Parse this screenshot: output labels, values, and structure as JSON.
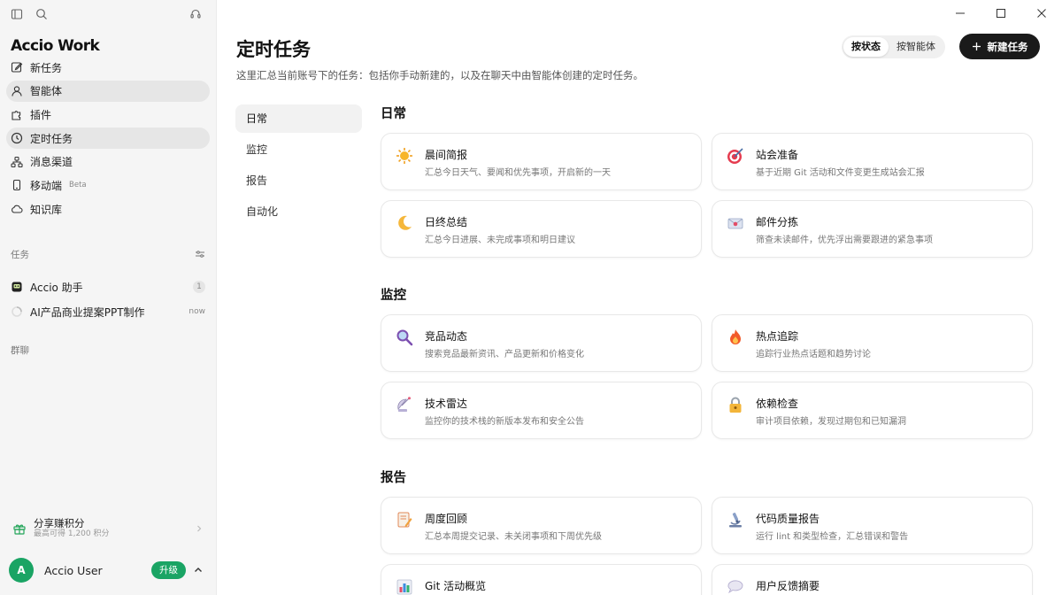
{
  "sidebar": {
    "brand": "Accio Work",
    "nav": [
      {
        "label": "新任务",
        "icon": "edit-icon"
      },
      {
        "label": "智能体",
        "icon": "user-icon"
      },
      {
        "label": "插件",
        "icon": "puzzle-icon"
      },
      {
        "label": "定时任务",
        "icon": "clock-icon"
      },
      {
        "label": "消息渠道",
        "icon": "channels-icon"
      },
      {
        "label": "移动端",
        "icon": "mobile-icon",
        "badge": "Beta"
      },
      {
        "label": "知识库",
        "icon": "cloud-icon"
      }
    ],
    "tasks_label": "任务",
    "tasks": [
      {
        "label": "Accio 助手",
        "meta": "1"
      },
      {
        "label": "AI产品商业提案PPT制作",
        "meta": "now"
      }
    ],
    "group_label": "群聊",
    "share": {
      "title": "分享赚积分",
      "subtitle": "最高可得 1,200 积分"
    },
    "user": {
      "initial": "A",
      "name": "Accio User",
      "upgrade": "升级"
    }
  },
  "header": {
    "title": "定时任务",
    "description": "这里汇总当前账号下的任务：包括你手动新建的，以及在聊天中由智能体创建的定时任务。",
    "toggle": [
      "按状态",
      "按智能体"
    ],
    "new_task": "新建任务"
  },
  "categories": [
    "日常",
    "监控",
    "报告",
    "自动化"
  ],
  "sections": [
    {
      "title": "日常",
      "cards": [
        {
          "title": "晨间简报",
          "desc": "汇总今日天气、要闻和优先事项，开启新的一天",
          "icon": "sun-icon"
        },
        {
          "title": "站会准备",
          "desc": "基于近期 Git 活动和文件变更生成站会汇报",
          "icon": "target-icon"
        },
        {
          "title": "日终总结",
          "desc": "汇总今日进展、未完成事项和明日建议",
          "icon": "moon-icon"
        },
        {
          "title": "邮件分拣",
          "desc": "筛查未读邮件，优先浮出需要跟进的紧急事项",
          "icon": "mail-icon"
        }
      ]
    },
    {
      "title": "监控",
      "cards": [
        {
          "title": "竞品动态",
          "desc": "搜索竞品最新资讯、产品更新和价格变化",
          "icon": "magnifier-icon"
        },
        {
          "title": "热点追踪",
          "desc": "追踪行业热点话题和趋势讨论",
          "icon": "fire-icon"
        },
        {
          "title": "技术雷达",
          "desc": "监控你的技术栈的新版本发布和安全公告",
          "icon": "satellite-icon"
        },
        {
          "title": "依赖检查",
          "desc": "审计项目依赖，发现过期包和已知漏洞",
          "icon": "lock-icon"
        }
      ]
    },
    {
      "title": "报告",
      "cards": [
        {
          "title": "周度回顾",
          "desc": "汇总本周提交记录、未关闭事项和下周优先级",
          "icon": "memo-icon"
        },
        {
          "title": "代码质量报告",
          "desc": "运行 lint 和类型检查，汇总错误和警告",
          "icon": "microscope-icon"
        },
        {
          "title": "Git 活动概览",
          "desc": "",
          "icon": "bar-chart-icon"
        },
        {
          "title": "用户反馈摘要",
          "desc": "",
          "icon": "speech-bubble-icon"
        }
      ]
    }
  ]
}
